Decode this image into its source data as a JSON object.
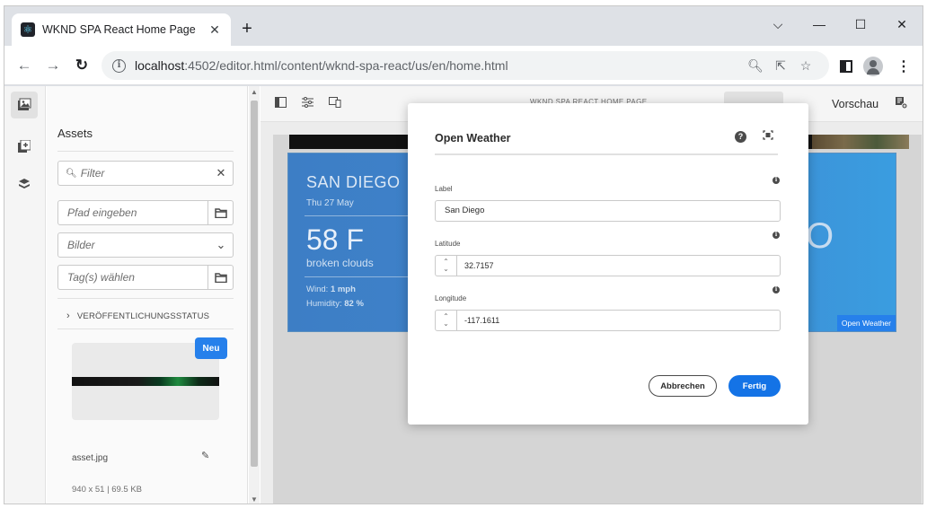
{
  "browser": {
    "tab_title": "WKND SPA React Home Page",
    "tab_close": "✕",
    "new_tab": "+",
    "window_controls": {
      "minimize_list": "⌵",
      "minimize": "—",
      "maximize": "☐",
      "close": "✕"
    },
    "url_host": "localhost",
    "url_rest": ":4502/editor.html/content/wknd-spa-react/us/en/home.html",
    "icons": [
      "back-icon",
      "forward-icon",
      "reload-icon",
      "info-icon",
      "zoom-icon",
      "share-icon",
      "star-icon",
      "sidepanel-icon",
      "profile-icon",
      "menu-icon"
    ]
  },
  "sidebar": {
    "title": "Assets",
    "filter_placeholder": "Filter",
    "path_placeholder": "Pfad eingeben",
    "type_value": "Bilder",
    "tags_placeholder": "Tag(s) wählen",
    "status_section": "VERÖFFENTLICHUNGSSTATUS",
    "asset": {
      "badge": "Neu",
      "name": "asset.jpg",
      "meta": "940 x 51 | 69.5 KB"
    }
  },
  "canvas_toolbar": {
    "page_title": "WKND SPA REACT HOME PAGE",
    "preview_label": "Vorschau"
  },
  "weather_card": {
    "city": "SAN DIEGO",
    "date": "Thu 27 May",
    "temp": "58 F",
    "description": "broken clouds",
    "wind_label": "Wind:",
    "wind_value": "1 mph",
    "humidity_label": "Humidity:",
    "humidity_value": "82 %",
    "component_tag": "Open Weather",
    "partial_right_text": "O"
  },
  "dialog": {
    "title": "Open Weather",
    "label_field": {
      "label": "Label",
      "value": "San Diego"
    },
    "latitude_field": {
      "label": "Latitude",
      "value": "32.7157"
    },
    "longitude_field": {
      "label": "Longitude",
      "value": "-117.1611"
    },
    "cancel_label": "Abbrechen",
    "done_label": "Fertig"
  },
  "colors": {
    "accent": "#1473e6",
    "badge": "#2680eb",
    "weather_bg": "#3f86cf"
  }
}
